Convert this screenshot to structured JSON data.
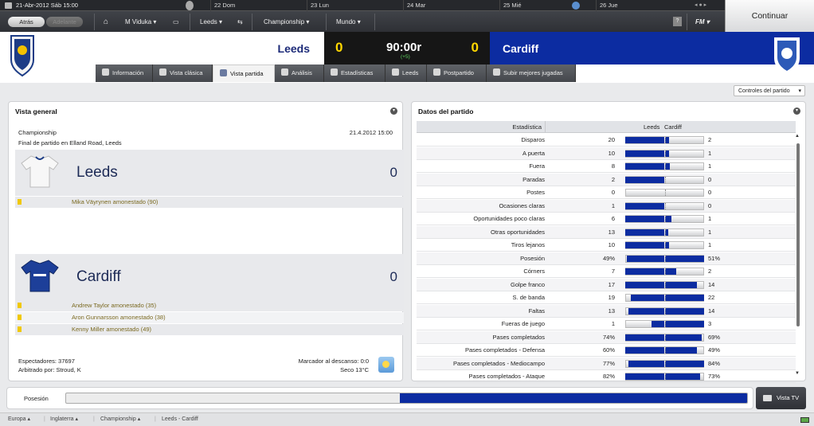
{
  "topbar": {
    "date": "21-Abr-2012 Sáb 15:00",
    "cal_days": [
      "22 Dom",
      "23 Lun",
      "24 Mar",
      "25 Mié",
      "26 Jue"
    ],
    "back": "Atrás",
    "forward": "Adelante",
    "manager": "M Viduka",
    "club": "Leeds",
    "competition": "Championship",
    "world": "Mundo",
    "help": "?",
    "fm": "FM",
    "continue": "Continuar"
  },
  "match": {
    "home": "Leeds",
    "away": "Cardiff",
    "home_goals": "0",
    "away_goals": "0",
    "time": "90:00r",
    "added": "(+5)"
  },
  "tabs": [
    "Información",
    "Vista clásica",
    "Vista partida",
    "Análisis",
    "Estadísticas",
    "Leeds",
    "Postpartido",
    "Subir mejores jugadas"
  ],
  "match_controls": "Controles del partido",
  "overview": {
    "title": "Vista general",
    "competition": "Championship",
    "datetime": "21.4.2012 15:00",
    "venue": "Final de partido en Elland Road, Leeds",
    "home_events": [
      "Mika Väyrynen amonestado (90)"
    ],
    "away_events": [
      "Andrew Taylor amonestado (35)",
      "Aron Gunnarsson amonestado (38)",
      "Kenny Miller amonestado (49)"
    ],
    "attendance": "Espectadores: 37697",
    "referee": "Arbitrado por: Stroud, K",
    "halftime": "Marcador al descanso: 0:0",
    "weather": "Seco 13°C"
  },
  "stats": {
    "title": "Datos del partido",
    "col_stat": "Estadística",
    "col_home": "Leeds",
    "col_away": "Cardiff",
    "rows": [
      {
        "name": "Disparos",
        "home": "20",
        "away": "2",
        "h": 20,
        "a": 2
      },
      {
        "name": "A puerta",
        "home": "10",
        "away": "1",
        "h": 10,
        "a": 1
      },
      {
        "name": "Fuera",
        "home": "8",
        "away": "1",
        "h": 8,
        "a": 1
      },
      {
        "name": "Paradas",
        "home": "2",
        "away": "0",
        "h": 2,
        "a": 0
      },
      {
        "name": "Postes",
        "home": "0",
        "away": "0",
        "h": 0,
        "a": 0
      },
      {
        "name": "Ocasiones claras",
        "home": "1",
        "away": "0",
        "h": 1,
        "a": 0
      },
      {
        "name": "Oportunidades poco claras",
        "home": "6",
        "away": "1",
        "h": 6,
        "a": 1
      },
      {
        "name": "Otras oportunidades",
        "home": "13",
        "away": "1",
        "h": 13,
        "a": 1
      },
      {
        "name": "Tiros lejanos",
        "home": "10",
        "away": "1",
        "h": 10,
        "a": 1
      },
      {
        "name": "Posesión",
        "home": "49%",
        "away": "51%",
        "h": 49,
        "a": 51
      },
      {
        "name": "Córners",
        "home": "7",
        "away": "2",
        "h": 7,
        "a": 2
      },
      {
        "name": "Golpe franco",
        "home": "17",
        "away": "14",
        "h": 17,
        "a": 14
      },
      {
        "name": "S. de banda",
        "home": "19",
        "away": "22",
        "h": 19,
        "a": 22
      },
      {
        "name": "Faltas",
        "home": "13",
        "away": "14",
        "h": 13,
        "a": 14
      },
      {
        "name": "Fueras de juego",
        "home": "1",
        "away": "3",
        "h": 1,
        "a": 3
      },
      {
        "name": "Pases completados",
        "home": "74%",
        "away": "69%",
        "h": 74,
        "a": 69
      },
      {
        "name": "Pases completados - Defensa",
        "home": "60%",
        "away": "49%",
        "h": 60,
        "a": 49
      },
      {
        "name": "Pases completados - Mediocampo",
        "home": "77%",
        "away": "84%",
        "h": 77,
        "a": 84
      },
      {
        "name": "Pases completados - Ataque",
        "home": "82%",
        "away": "73%",
        "h": 82,
        "a": 73
      }
    ]
  },
  "possession": {
    "label": "Posesión",
    "home_share": 0.49
  },
  "tv": "Vista TV",
  "breadcrumbs": [
    "Europa",
    "Inglaterra",
    "Championship",
    "Leeds - Cardiff"
  ],
  "colors": {
    "away_blue": "#0c2ca1",
    "score_yellow": "#ffd800",
    "card_yellow": "#f0c800"
  }
}
